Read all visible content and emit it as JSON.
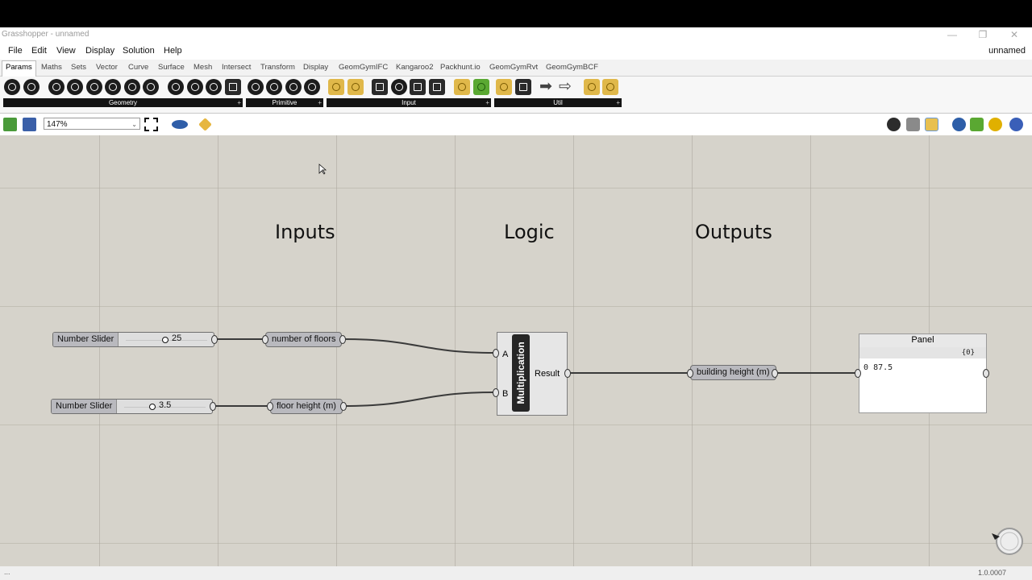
{
  "window": {
    "title": "Grasshopper - unnamed",
    "minimize_glyph": "—",
    "maximize_glyph": "❐",
    "close_glyph": "✕"
  },
  "menu": {
    "items": [
      "File",
      "Edit",
      "View",
      "Display",
      "Solution",
      "Help"
    ],
    "doc_name": "unnamed"
  },
  "tabs": [
    "Params",
    "Maths",
    "Sets",
    "Vector",
    "Curve",
    "Surface",
    "Mesh",
    "Intersect",
    "Transform",
    "Display",
    "GeomGymIFC",
    "Kangaroo2",
    "Packhunt.io",
    "GeomGymRvt",
    "GeomGymBCF"
  ],
  "active_tab": "Params",
  "ribbon_groups": [
    "Geometry",
    "Primitive",
    "Input",
    "Util"
  ],
  "ribbon_plus_glyph": "+",
  "zoom": {
    "value": "147%",
    "dropdown_glyph": "⌄"
  },
  "canvas": {
    "groups": [
      "Inputs",
      "Logic",
      "Outputs"
    ],
    "sliders": [
      {
        "label": "Number Slider",
        "value": "25"
      },
      {
        "label": "Number Slider",
        "value": "3.5"
      }
    ],
    "params": {
      "floors": "number of floors",
      "floor_height": "floor height (m)",
      "building_height": "building height (m)"
    },
    "multiplication": {
      "name": "Multiplication",
      "input_a": "A",
      "input_b": "B",
      "output": "Result"
    },
    "panel": {
      "title": "Panel",
      "branch": "{0}",
      "index": "0",
      "value": "87.5"
    }
  },
  "status": {
    "dots": "...",
    "version": "1.0.0007"
  },
  "colors": {
    "canvas": "#d6d3cb",
    "component": "#b9b9be",
    "wire": "#3a3a3a",
    "dark_bar": "#262626"
  }
}
